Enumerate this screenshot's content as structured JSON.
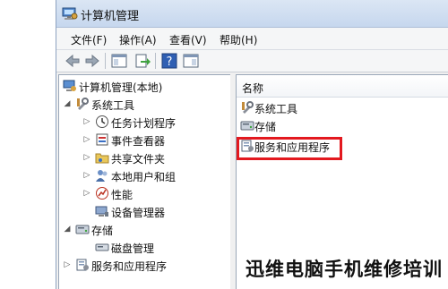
{
  "window": {
    "title": "计算机管理",
    "title_icon": "computer-management-icon"
  },
  "menu": {
    "file": "文件(F)",
    "action": "操作(A)",
    "view": "查看(V)",
    "help": "帮助(H)"
  },
  "toolbar": {
    "buttons": [
      "back-icon",
      "forward-icon",
      "show-hide-tree-icon",
      "export-list-icon",
      "help-icon",
      "properties-icon"
    ]
  },
  "tree": {
    "root": "计算机管理(本地)",
    "system_tools": "系统工具",
    "task_scheduler": "任务计划程序",
    "event_viewer": "事件查看器",
    "shared_folders": "共享文件夹",
    "local_users": "本地用户和组",
    "performance": "性能",
    "device_manager": "设备管理器",
    "storage": "存储",
    "disk_management": "磁盘管理",
    "services_apps": "服务和应用程序"
  },
  "list": {
    "column_name": "名称",
    "items": [
      "系统工具",
      "存储",
      "服务和应用程序"
    ],
    "highlighted_item": "服务和应用程序",
    "highlight_color": "#e3191f"
  },
  "watermark": "迅维电脑手机维修培训"
}
